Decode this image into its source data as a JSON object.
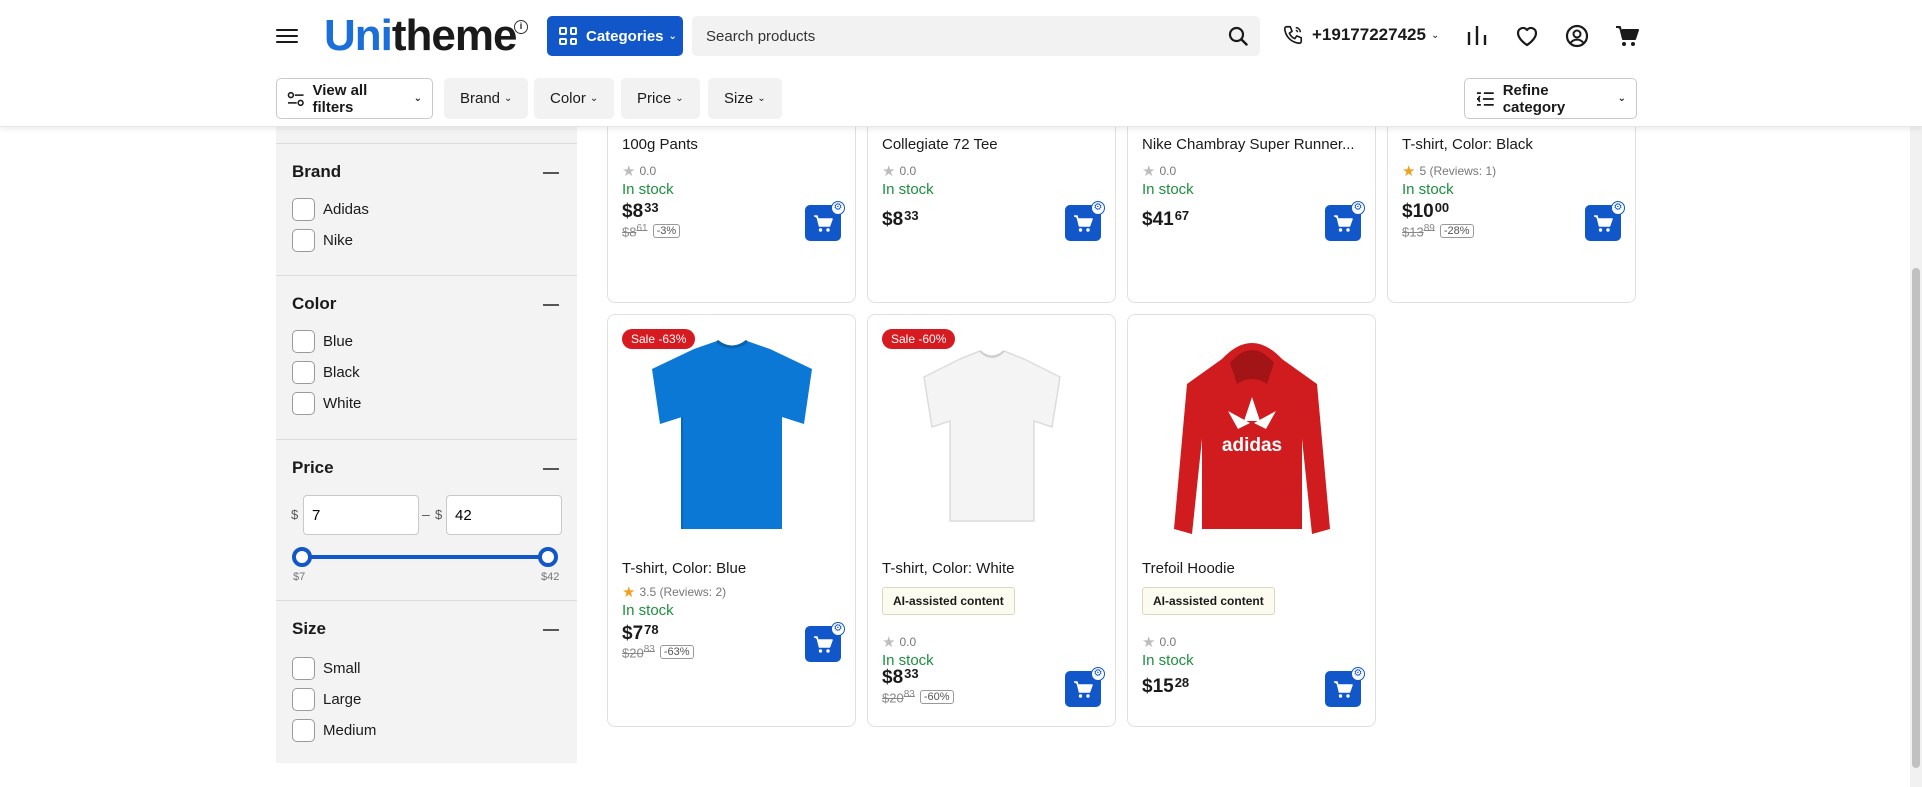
{
  "header": {
    "logo_brand": "Uni",
    "logo_rest": "theme",
    "categories_label": "Categories",
    "search_placeholder": "Search products",
    "phone": "+19177227425"
  },
  "filterbar": {
    "view_all": "View all filters",
    "brand": "Brand",
    "color": "Color",
    "price": "Price",
    "size": "Size",
    "refine": "Refine category"
  },
  "sidebar": {
    "brand": {
      "title": "Brand",
      "options": [
        "Adidas",
        "Nike"
      ]
    },
    "color": {
      "title": "Color",
      "options": [
        "Blue",
        "Black",
        "White"
      ]
    },
    "price": {
      "title": "Price",
      "currency": "$",
      "min": "7",
      "max": "42",
      "min_label": "$7",
      "max_label": "$42"
    },
    "size": {
      "title": "Size",
      "options": [
        "Small",
        "Large",
        "Medium"
      ]
    }
  },
  "products": [
    {
      "name": "100g Pants",
      "rating": "0.0",
      "stock": "In stock",
      "price_main": "$8",
      "price_cents": "33",
      "old_price": "$8.61",
      "old_main": "$8",
      "old_cents": "61",
      "discount": "-3%"
    },
    {
      "name": "Collegiate 72 Tee",
      "rating": "0.0",
      "stock": "In stock",
      "price_main": "$8",
      "price_cents": "33"
    },
    {
      "name": "Nike Chambray Super Runner...",
      "rating": "0.0",
      "stock": "In stock",
      "price_main": "$41",
      "price_cents": "67"
    },
    {
      "name": "T-shirt, Color: Black",
      "rating": "5 (Reviews: 1)",
      "stock": "In stock",
      "price_main": "$10",
      "price_cents": "00",
      "old_main": "$13",
      "old_cents": "89",
      "discount": "-28%"
    },
    {
      "name": "T-shirt, Color: Blue",
      "sale": "Sale -63%",
      "rating": "3.5 (Reviews: 2)",
      "stock": "In stock",
      "price_main": "$7",
      "price_cents": "78",
      "old_main": "$20",
      "old_cents": "83",
      "discount": "-63%",
      "image": "blue-tshirt"
    },
    {
      "name": "T-shirt, Color: White",
      "sale": "Sale -60%",
      "ai": "AI-assisted content",
      "rating": "0.0",
      "stock": "In stock",
      "price_main": "$8",
      "price_cents": "33",
      "old_main": "$20",
      "old_cents": "83",
      "discount": "-60%",
      "image": "white-tshirt"
    },
    {
      "name": "Trefoil Hoodie",
      "ai": "AI-assisted content",
      "rating": "0.0",
      "stock": "In stock",
      "price_main": "$15",
      "price_cents": "28",
      "image": "red-hoodie",
      "image_text": "adidas"
    }
  ],
  "colors": {
    "accent": "#1257c9",
    "brand_blue": "#1b6fd8",
    "in_stock": "#1d8f3e",
    "sale": "#d71920",
    "star": "#f0a020"
  }
}
